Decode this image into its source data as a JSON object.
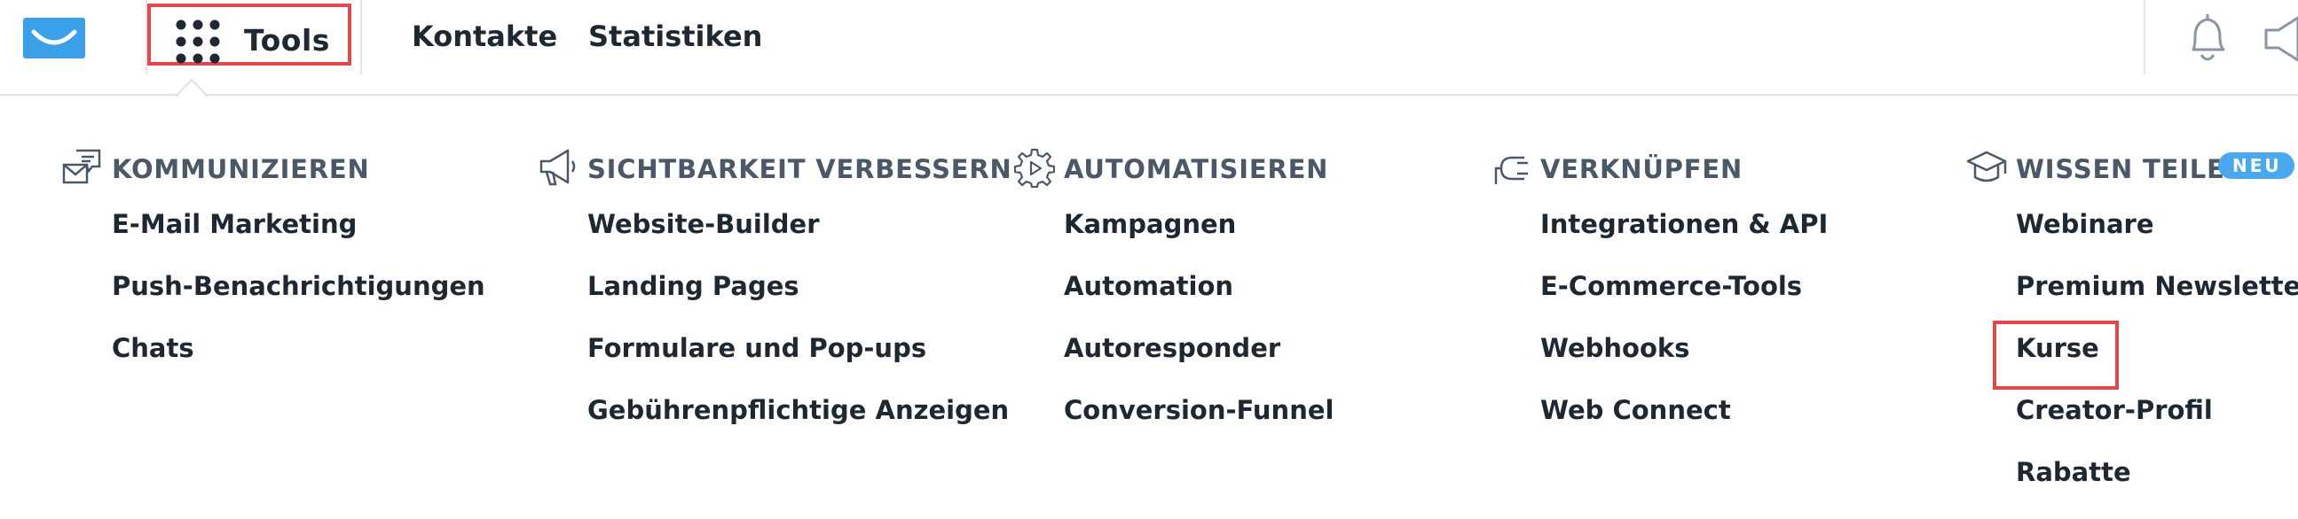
{
  "topbar": {
    "logo_icon": "envelope-logo-icon",
    "tools_label": "Tools",
    "nav_links": [
      "Kontakte",
      "Statistiken"
    ],
    "right_icons": [
      "bell-icon",
      "megaphone-icon"
    ]
  },
  "menu": {
    "columns": [
      {
        "icon": "chat-envelope-icon",
        "title": "KOMMUNIZIEREN",
        "items": [
          "E-Mail Marketing",
          "Push-Benachrichtigungen",
          "Chats"
        ]
      },
      {
        "icon": "megaphone-icon",
        "title": "SICHTBARKEIT VERBESSERN",
        "items": [
          "Website-Builder",
          "Landing Pages",
          "Formulare und Pop-ups",
          "Gebührenpflichtige Anzeigen"
        ]
      },
      {
        "icon": "gear-play-icon",
        "title": "AUTOMATISIEREN",
        "items": [
          "Kampagnen",
          "Automation",
          "Autoresponder",
          "Conversion-Funnel"
        ]
      },
      {
        "icon": "plug-icon",
        "title": "VERKNÜPFEN",
        "items": [
          "Integrationen & API",
          "E-Commerce-Tools",
          "Webhooks",
          "Web Connect"
        ]
      },
      {
        "icon": "graduation-cap-icon",
        "title": "WISSEN TEILEN",
        "badge": "NEU",
        "items": [
          "Webinare",
          "Premium Newsletter",
          "Kurse",
          "Creator-Profil",
          "Rabatte"
        ]
      }
    ]
  },
  "colors": {
    "accent_blue": "#4aa8ee",
    "highlight_red": "#e0484c",
    "text_dark": "#1e2833",
    "heading_gray": "#4a5868"
  }
}
